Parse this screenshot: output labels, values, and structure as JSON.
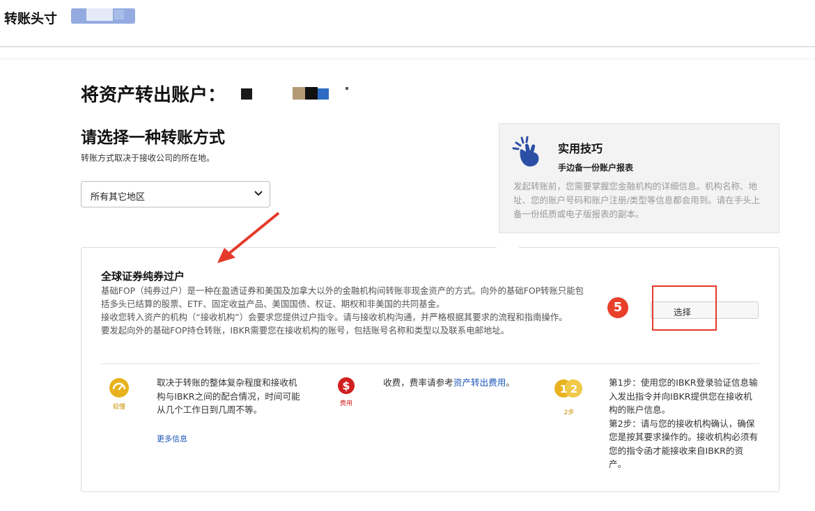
{
  "header": {
    "title": "转账头寸",
    "redaction_colors": [
      "#6f8fd6",
      "#a9bde9"
    ]
  },
  "page": {
    "heading": "将资产转出账户：",
    "redaction_colors": [
      "#1a1a1a",
      "#b59a78",
      "#111111",
      "#2d6bc4"
    ]
  },
  "method": {
    "title": "请选择一种转账方式",
    "description": "转账方式取决于接收公司的所在地。",
    "region_select": {
      "value": "所有其它地区"
    }
  },
  "tip": {
    "icon": "snap-fingers-icon",
    "title": "实用技巧",
    "subtitle": "手边备一份账户报表",
    "body": "发起转账前，您需要掌握您金融机构的详细信息。机构名称、地址、您的账户号码和账户注册/类型等信息都会用到。请在手头上备一份纸质或电子版报表的副本。"
  },
  "transfer_option": {
    "title": "全球证券纯券过户",
    "paragraphs": [
      "基础FOP（纯券过户）是一种在盈透证券和美国及加拿大以外的金融机构间转账非现金资产的方式。向外的基础FOP转账只能包括多头已结算的股票、ETF、固定收益产品、美国国债、权证、期权和非美国的共同基金。",
      "接收您转入资产的机构（“接收机构”）会要求您提供过户指令。请与接收机构沟通，并严格根据其要求的流程和指南操作。",
      "要发起向外的基础FOP持仓转账，IBKR需要您在接收机构的账号，包括账号名称和类型以及联系电邮地址。"
    ],
    "step_badge": "5",
    "select_label": "选择",
    "features": [
      {
        "icon": "speedometer-icon",
        "caption": "较慢",
        "text": "取决于转账的整体复杂程度和接收机构与IBKR之间的配合情况，时间可能从几个工作日到几周不等。",
        "link": "更多信息",
        "color": "#e7b21e"
      },
      {
        "icon": "dollar-fee-icon",
        "caption": "费用",
        "text": "收费，费率请参考",
        "link": "资产转出费用",
        "text_after": "。",
        "color": "#d11f1f"
      },
      {
        "icon": "steps-icon",
        "caption": "2步",
        "text": "第1步：使用您的IBKR登录验证信息输入发出指令并向IBKR提供您在接收机构的账户信息。\n第2步：请与您的接收机构确认，确保您是按其要求操作的。接收机构必须有您的指令函才能接收来自IBKR的资产。",
        "color": "#e7b21e"
      }
    ]
  },
  "colors": {
    "highlight": "#e5392a",
    "link": "#1a56b8",
    "tip_icon": "#2c4fa6"
  }
}
